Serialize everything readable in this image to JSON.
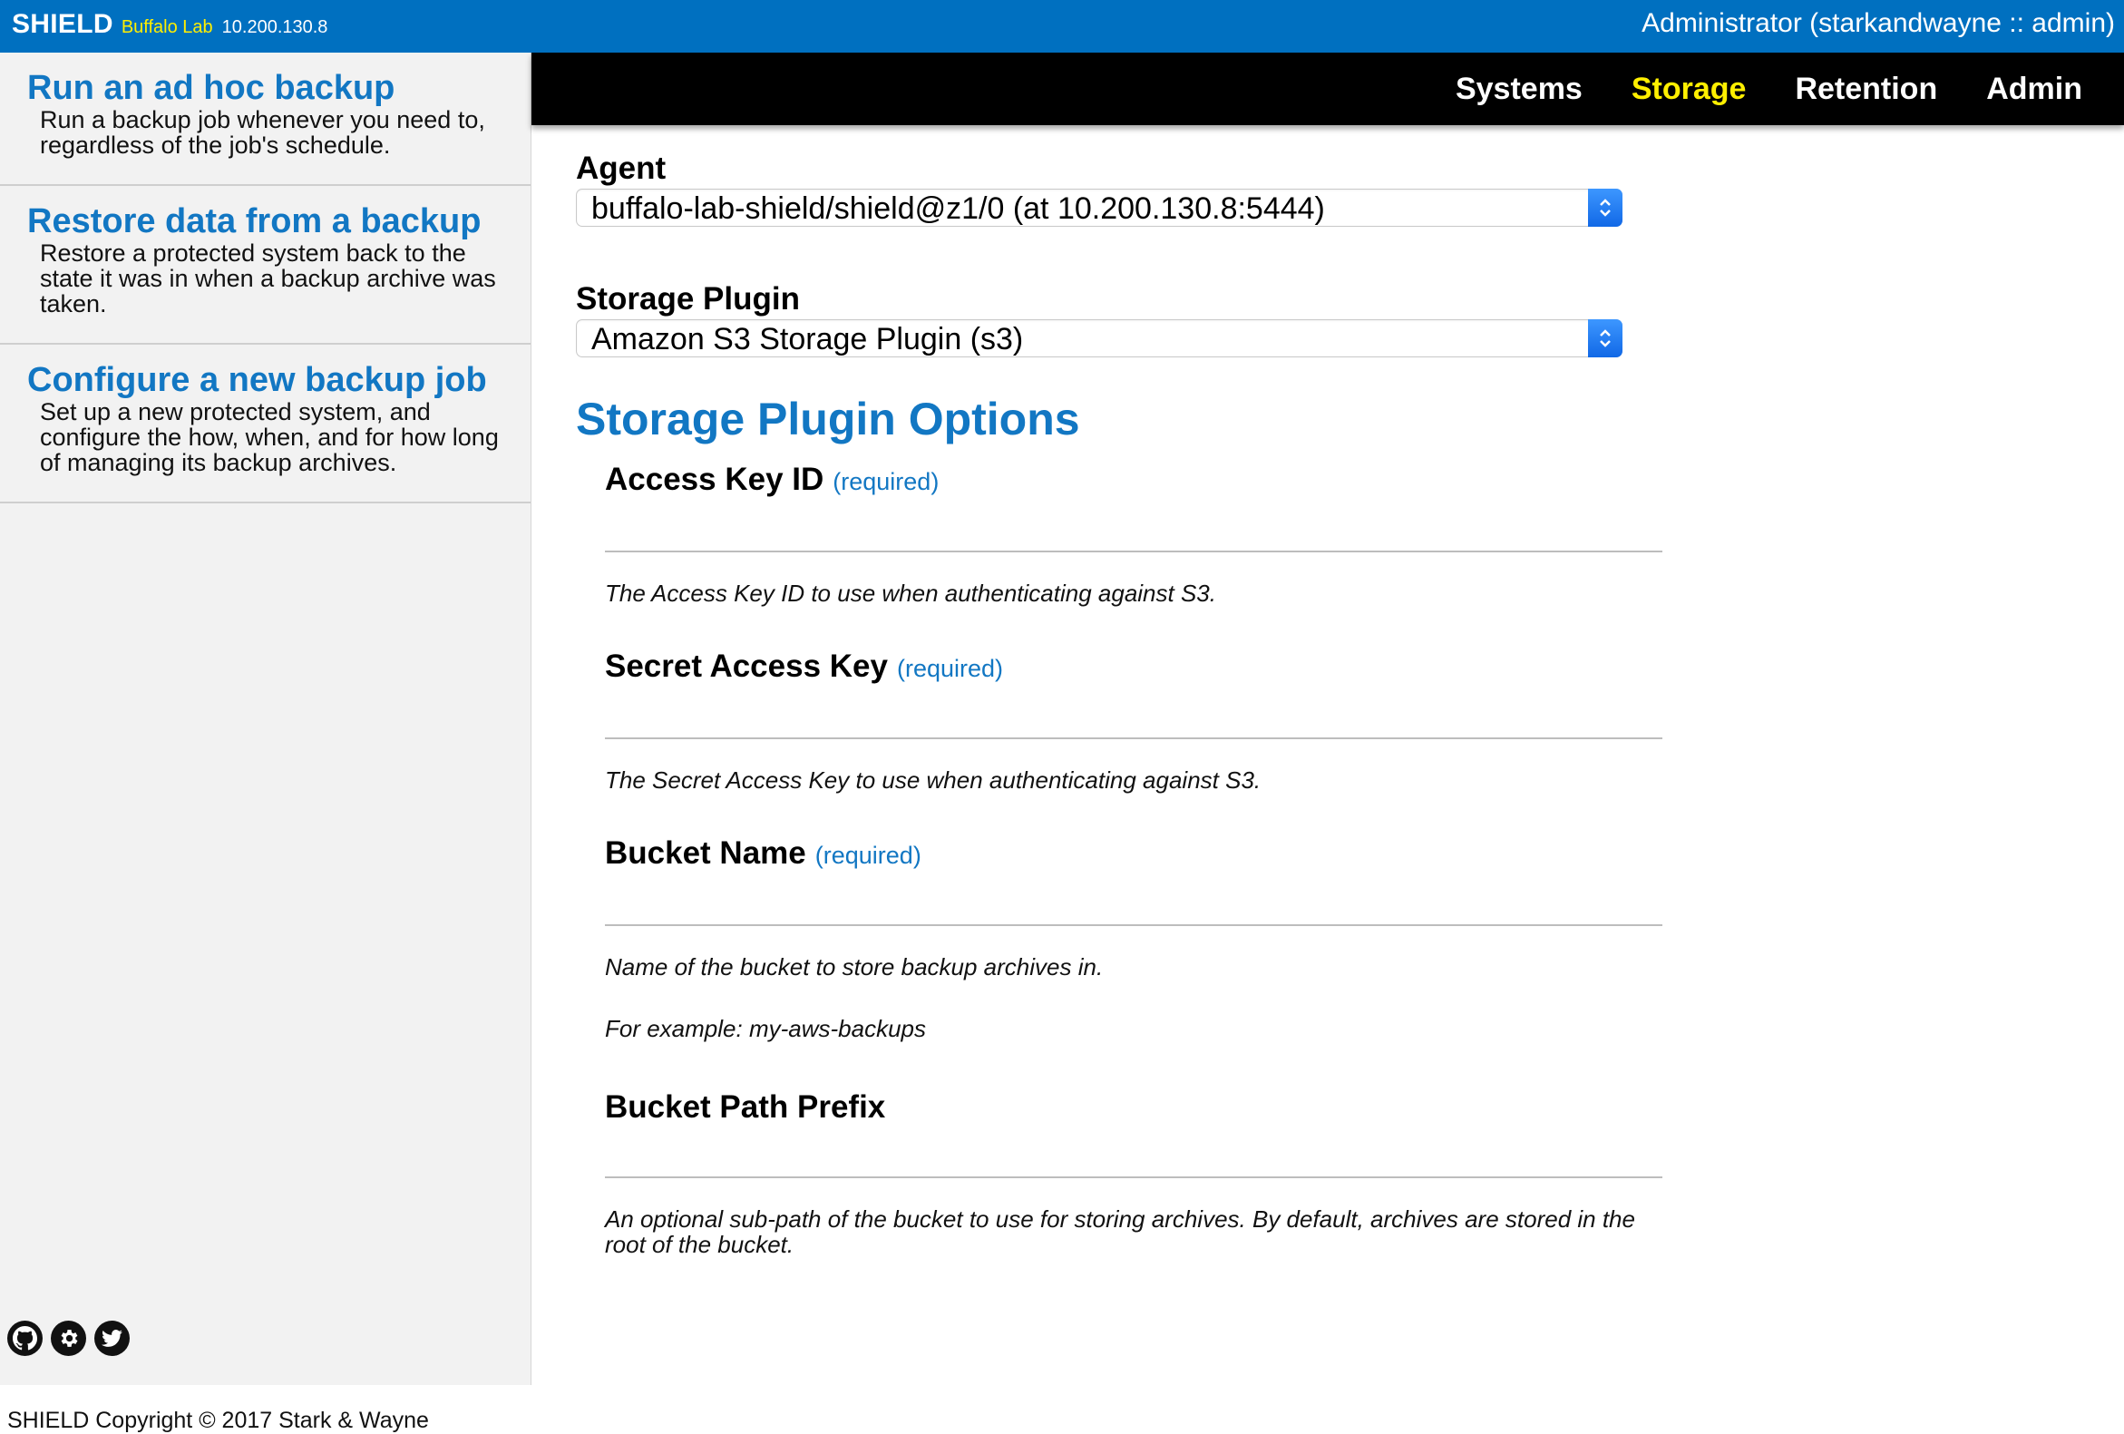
{
  "header": {
    "brand": "SHIELD",
    "environment": "Buffalo Lab",
    "ip": "10.200.130.8",
    "user": "Administrator (starkandwayne :: admin)"
  },
  "nav": {
    "items": [
      {
        "label": "Systems",
        "active": false
      },
      {
        "label": "Storage",
        "active": true
      },
      {
        "label": "Retention",
        "active": false
      },
      {
        "label": "Admin",
        "active": false
      }
    ]
  },
  "sidebar": {
    "items": [
      {
        "title": "Run an ad hoc backup",
        "description": "Run a backup job whenever you need to, regardless of the job's schedule."
      },
      {
        "title": "Restore data from a backup",
        "description": "Restore a protected system back to the state it was in when a backup archive was taken."
      },
      {
        "title": "Configure a new backup job",
        "description": "Set up a new protected system, and configure the how, when, and for how long of managing its backup archives."
      }
    ],
    "social_icons": [
      "github-icon",
      "gear-icon",
      "twitter-icon"
    ],
    "copyright": "SHIELD Copyright © 2017 Stark & Wayne"
  },
  "form": {
    "agent_label": "Agent",
    "agent_value": "buffalo-lab-shield/shield@z1/0 (at 10.200.130.8:5444)",
    "plugin_label": "Storage Plugin",
    "plugin_value": "Amazon S3 Storage Plugin (s3)",
    "options_title": "Storage Plugin Options",
    "options": [
      {
        "label": "Access Key ID",
        "required": "(required)",
        "value": "",
        "help": "The Access Key ID to use when authenticating against S3."
      },
      {
        "label": "Secret Access Key",
        "required": "(required)",
        "value": "",
        "help": "The Secret Access Key to use when authenticating against S3."
      },
      {
        "label": "Bucket Name",
        "required": "(required)",
        "value": "",
        "help": "Name of the bucket to store backup archives in.",
        "example": "For example: my-aws-backups"
      },
      {
        "label": "Bucket Path Prefix",
        "value": "",
        "help": "An optional sub-path of the bucket to use for storing archives. By default, archives are stored in the root of the bucket."
      }
    ]
  },
  "colors": {
    "header_bg": "#0070c0",
    "accent_blue": "#1277c3",
    "active_nav": "#ffef00",
    "nav_bg": "#000000",
    "sidebar_bg": "#f2f2f2"
  }
}
